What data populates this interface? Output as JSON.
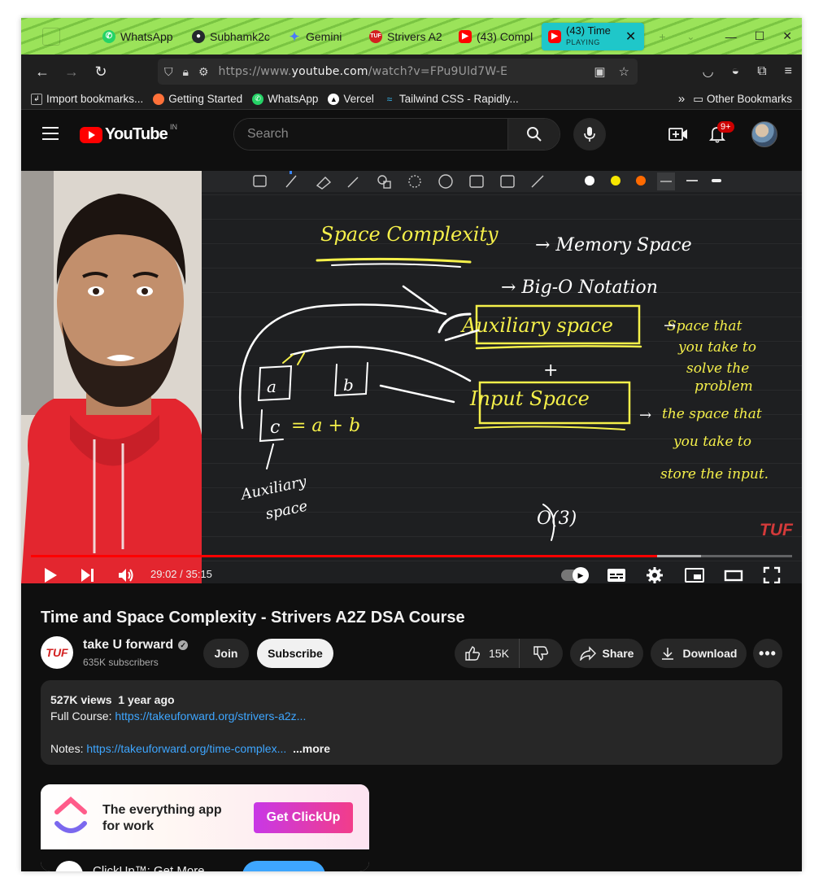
{
  "browser": {
    "tabs": [
      {
        "label": "WhatsApp",
        "color": "#25d366"
      },
      {
        "label": "Subhamk2c",
        "color": "#24292e"
      },
      {
        "label": "Gemini",
        "color": "#4a7bf7"
      },
      {
        "label": "Strivers A2",
        "color": "#d32020"
      },
      {
        "label": "(43) Compl",
        "color": "#ff0000"
      }
    ],
    "active_tab": {
      "title": "(43) Time",
      "status": "PLAYING"
    },
    "url_domain": "youtube.com",
    "url_prefix": "https://www.",
    "url_path": "/watch?v=FPu9Uld7W-E",
    "bookmarks": [
      {
        "label": "Import bookmarks...",
        "color": "#555555"
      },
      {
        "label": "Getting Started",
        "color": "#ff7139"
      },
      {
        "label": "WhatsApp",
        "color": "#25d366"
      },
      {
        "label": "Vercel",
        "color": "#000000"
      },
      {
        "label": "Tailwind CSS - Rapidly...",
        "color": "#38bdf8"
      }
    ],
    "other_bookmarks": "Other Bookmarks"
  },
  "youtube": {
    "logo_text": "YouTube",
    "country": "IN",
    "search_placeholder": "Search",
    "notif_count": "9+"
  },
  "player": {
    "current_time": "29:02",
    "duration": "35:15",
    "time_display": "29:02 / 35:15",
    "played_fraction": 0.823,
    "buffered_fraction": 0.88,
    "watermark": "TUF"
  },
  "board": {
    "lines": [
      "Space Complexity",
      "→  Memory Space",
      "→  Big-O Notation",
      "Auxiliary space",
      "→ Space that you take to solve the problem",
      "+",
      "Input Space",
      "→ the space that you take to store the input.",
      "a",
      "b",
      "c = a + b",
      "Auxiliary space",
      "O(3)"
    ]
  },
  "video": {
    "title": "Time and Space Complexity - Strivers A2Z DSA Course",
    "channel": "take U forward",
    "channel_logo": "TUF",
    "subscribers": "635K subscribers",
    "join": "Join",
    "subscribe": "Subscribe",
    "likes": "15K",
    "share": "Share",
    "download": "Download"
  },
  "description": {
    "views": "527K views",
    "age": "1 year ago",
    "full_course_label": "Full Course:",
    "full_course_link": "https://takeuforward.org/strivers-a2z...",
    "notes_label": "Notes:",
    "notes_link": "https://takeuforward.org/time-complex...",
    "more": "...more"
  },
  "ad": {
    "headline_1": "The everything app",
    "headline_2": "for work",
    "cta": "Get ClickUp",
    "sponsor_text": "ClickUp™: Get More"
  }
}
